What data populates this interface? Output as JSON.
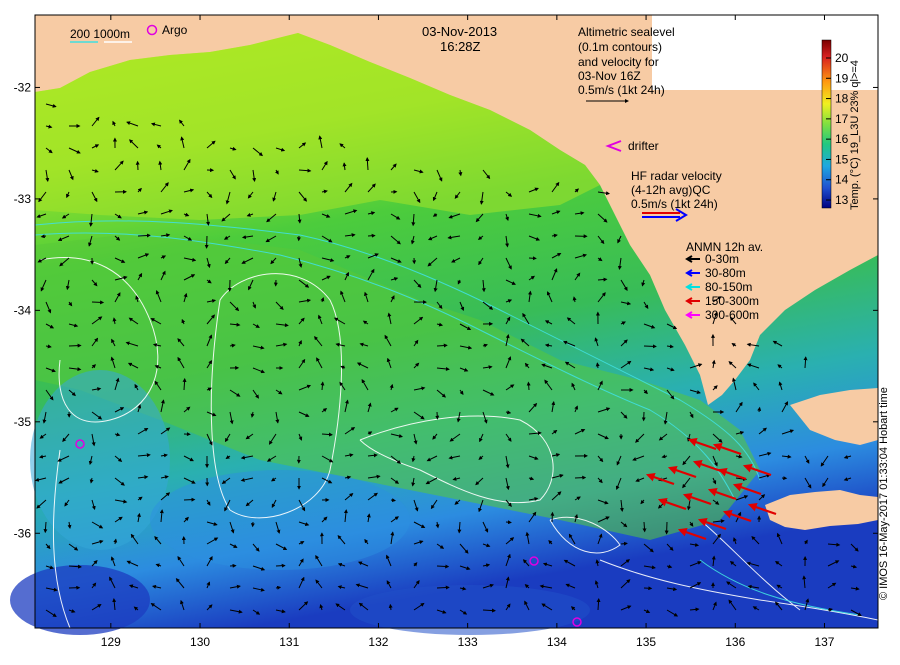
{
  "map": {
    "date": "03-Nov-2013",
    "time": "16:28Z",
    "x_ticks": [
      "129",
      "130",
      "131",
      "132",
      "133",
      "134",
      "135",
      "136",
      "137"
    ],
    "y_ticks": [
      "-32",
      "-33",
      "-34",
      "-35",
      "-36"
    ],
    "lon_range": [
      128.15,
      137.6
    ],
    "lat_range": [
      -36.85,
      -31.35
    ],
    "colors": {
      "land": "#f7cba4",
      "ocean_warm": "#c8f020",
      "ocean_mid": "#40c840",
      "ocean_cool": "#30a8d8",
      "ocean_cold": "#1a40c0"
    }
  },
  "legend_top": {
    "depth_label": "200  1000m",
    "argo_label": "Argo"
  },
  "altimetry": {
    "lines": [
      "Altimetric sealevel",
      "(0.1m contours)",
      "and velocity for",
      "03-Nov 16Z",
      "0.5m/s (1kt 24h)"
    ]
  },
  "drifter": {
    "label": "drifter"
  },
  "hf_radar": {
    "lines": [
      "HF radar velocity",
      "(4-12h avg)QC",
      "0.5m/s (1kt 24h)"
    ]
  },
  "anmn": {
    "title": "ANMN 12h av.",
    "items": [
      {
        "label": "0-30m",
        "color": "#000000"
      },
      {
        "label": "30-80m",
        "color": "#0000ff"
      },
      {
        "label": "80-150m",
        "color": "#00e0e0"
      },
      {
        "label": "150-300m",
        "color": "#e00000"
      },
      {
        "label": "300-600m",
        "color": "#ff00ff"
      }
    ]
  },
  "colorbar": {
    "ticks": [
      "20",
      "19",
      "18",
      "17",
      "16",
      "15",
      "14",
      "13"
    ],
    "label": "Temp. (°C) 19_L3U 23% ql>=4"
  },
  "credit": "© IMOS 16-May-2017 01:33:04 Hobart time"
}
